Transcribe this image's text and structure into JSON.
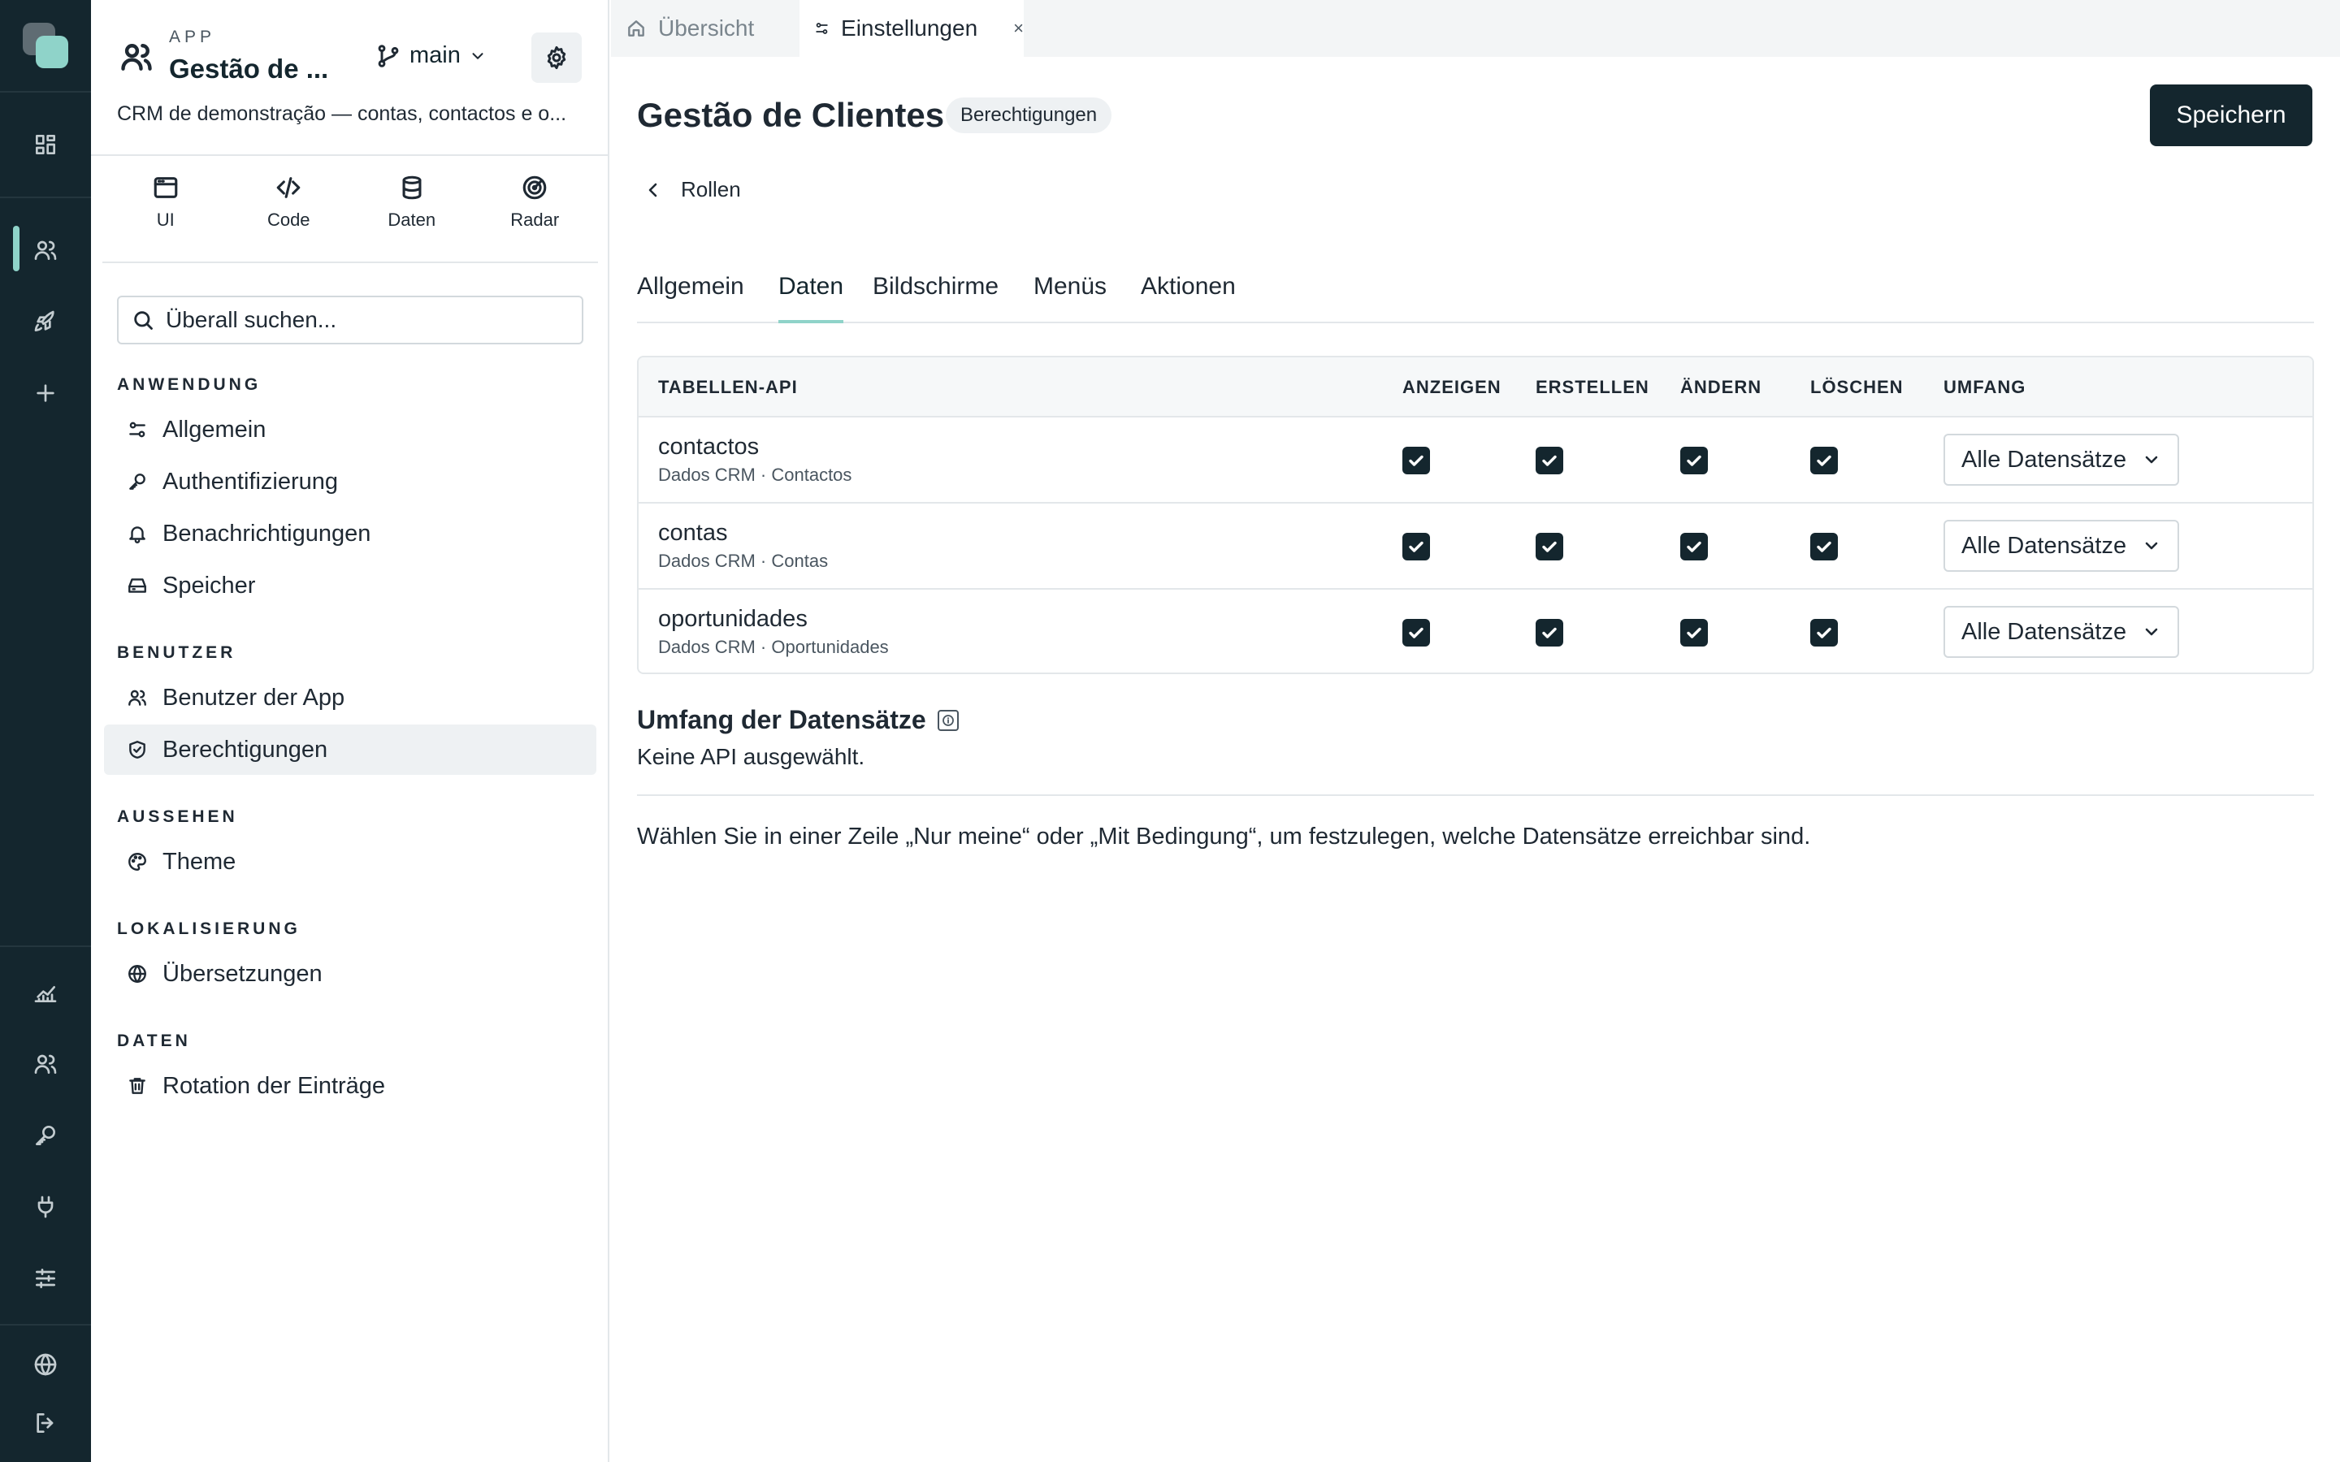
{
  "sidebar": {
    "app_kicker": "APP",
    "app_name": "Gestão de ...",
    "branch": "main",
    "description": "CRM de demonstração — contas, contactos e o...",
    "modes": [
      {
        "label": "UI",
        "icon": "browser-window-icon"
      },
      {
        "label": "Code",
        "icon": "code-icon"
      },
      {
        "label": "Daten",
        "icon": "database-icon"
      },
      {
        "label": "Radar",
        "icon": "radar-icon"
      }
    ],
    "search_placeholder": "Überall suchen...",
    "sections": {
      "anwendung": "ANWENDUNG",
      "benutzer": "BENUTZER",
      "aussehen": "AUSSEHEN",
      "lokalisierung": "LOKALISIERUNG",
      "daten": "DATEN"
    },
    "items": {
      "allgemein": "Allgemein",
      "authentifizierung": "Authentifizierung",
      "benachrichtigungen": "Benachrichtigungen",
      "speicher": "Speicher",
      "benutzer_app": "Benutzer der App",
      "berechtigungen": "Berechtigungen",
      "theme": "Theme",
      "uebersetzungen": "Übersetzungen",
      "rotation": "Rotation der Einträge"
    }
  },
  "tabs": {
    "overview": "Übersicht",
    "settings": "Einstellungen",
    "close": "×"
  },
  "main": {
    "title": "Gestão de Clientes",
    "badge": "Berechtigungen",
    "save": "Speichern",
    "back": "Rollen",
    "subtabs": {
      "allgemein": "Allgemein",
      "daten": "Daten",
      "bildschirme": "Bildschirme",
      "menues": "Menüs",
      "aktionen": "Aktionen"
    },
    "active_subtab": "Daten"
  },
  "table": {
    "headers": {
      "api": "TABELLEN-API",
      "anzeigen": "ANZEIGEN",
      "erstellen": "ERSTELLEN",
      "aendern": "ÄNDERN",
      "loeschen": "LÖSCHEN",
      "umfang": "UMFANG"
    },
    "rows": [
      {
        "name": "contactos",
        "source": "Dados CRM · Contactos",
        "anzeigen": true,
        "erstellen": true,
        "aendern": true,
        "loeschen": true,
        "umfang": "Alle Datensätze"
      },
      {
        "name": "contas",
        "source": "Dados CRM · Contas",
        "anzeigen": true,
        "erstellen": true,
        "aendern": true,
        "loeschen": true,
        "umfang": "Alle Datensätze"
      },
      {
        "name": "oportunidades",
        "source": "Dados CRM · Oportunidades",
        "anzeigen": true,
        "erstellen": true,
        "aendern": true,
        "loeschen": true,
        "umfang": "Alle Datensätze"
      }
    ]
  },
  "scope": {
    "title": "Umfang der Datensätze",
    "empty": "Keine API ausgewählt.",
    "hint": "Wählen Sie in einer Zeile „Nur meine“ oder „Mit Bedingung“, um festzulegen, welche Datensätze erreichbar sind."
  },
  "colors": {
    "rail_bg": "#14262e",
    "accent": "#8fd3c9",
    "primary_button": "#14262e",
    "checkbox": "#14262e"
  }
}
